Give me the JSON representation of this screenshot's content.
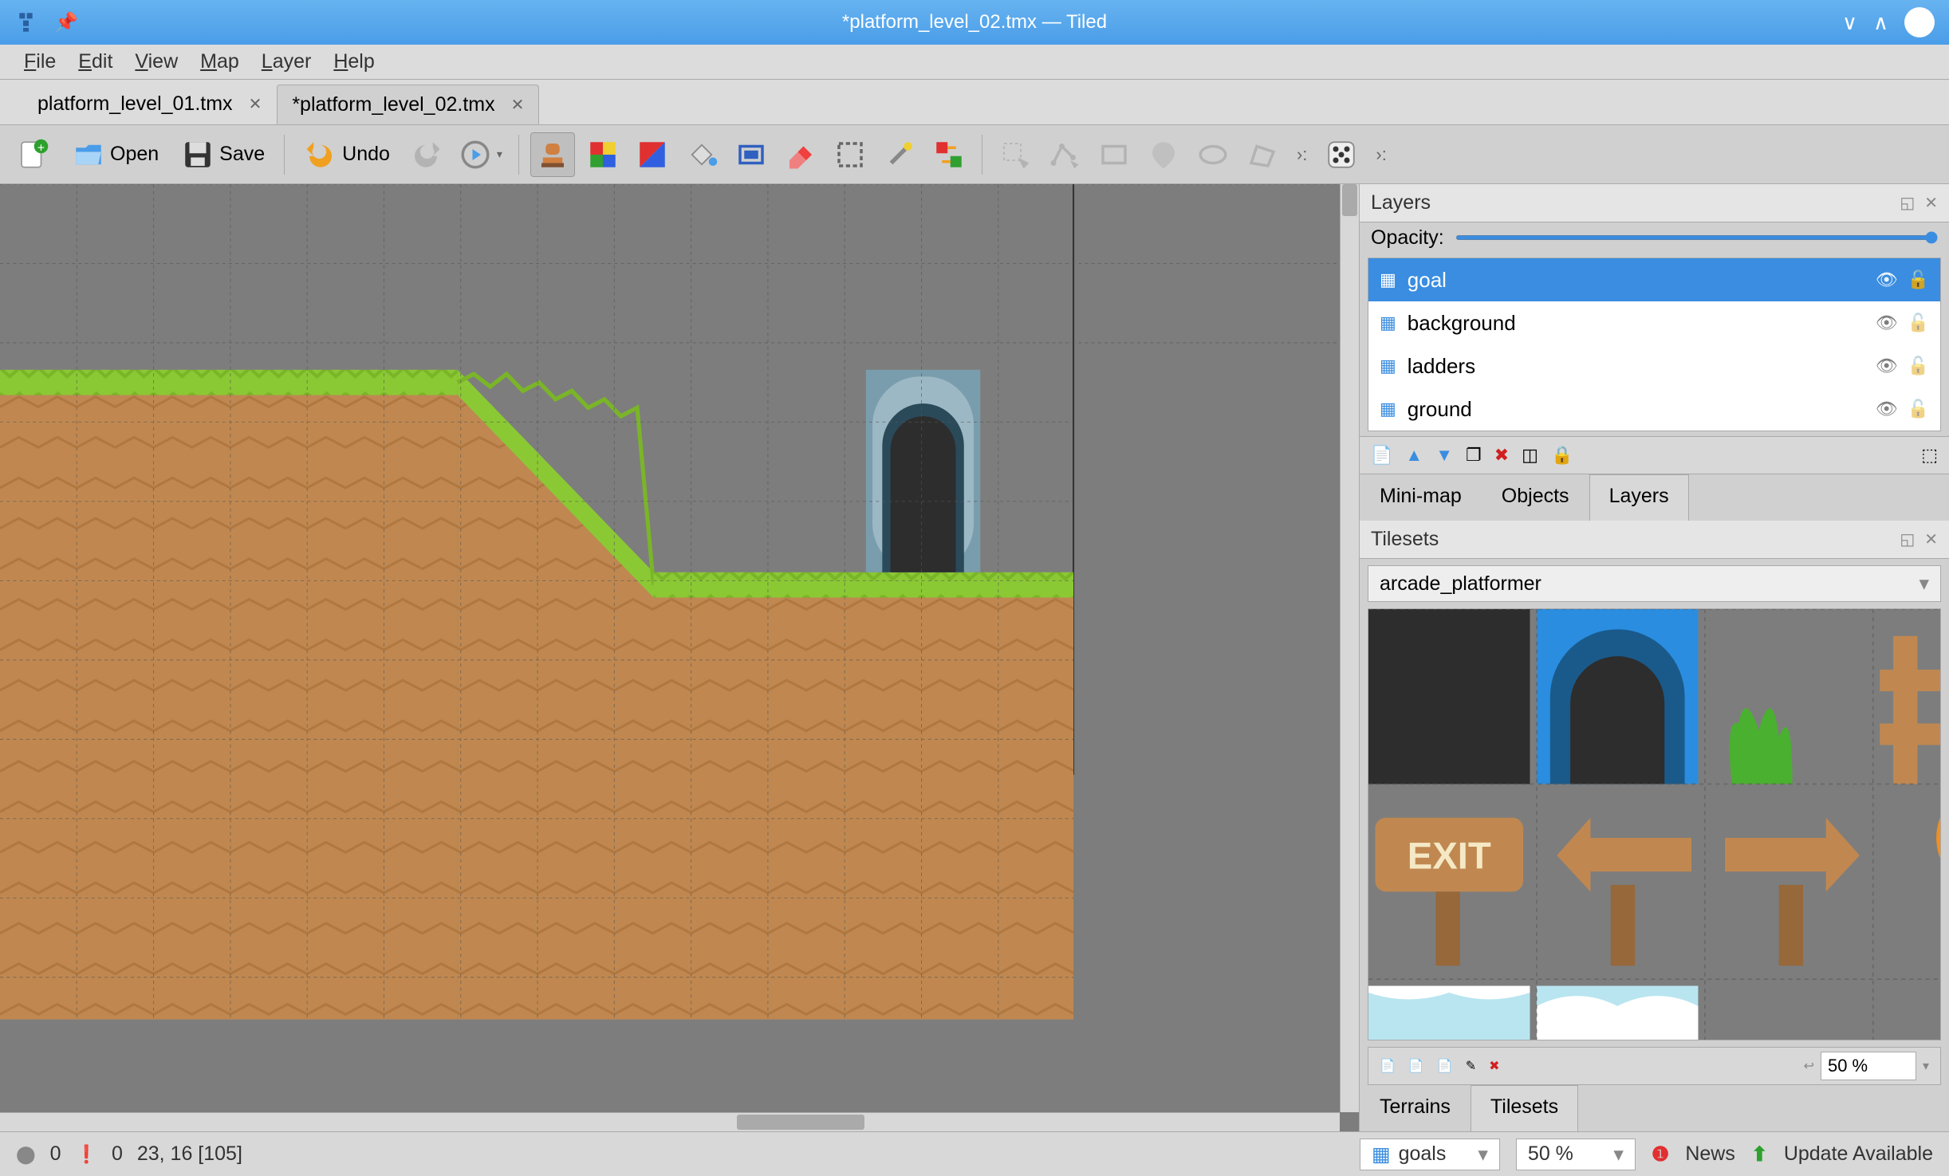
{
  "window": {
    "title": "*platform_level_02.tmx — Tiled"
  },
  "menu": [
    "File",
    "Edit",
    "View",
    "Map",
    "Layer",
    "Help"
  ],
  "tabs": [
    {
      "label": "platform_level_01.tmx",
      "active": false
    },
    {
      "label": "*platform_level_02.tmx",
      "active": true
    }
  ],
  "toolbar": {
    "open": "Open",
    "save": "Save",
    "undo": "Undo"
  },
  "layers_panel": {
    "title": "Layers",
    "opacity_label": "Opacity:",
    "layers": [
      {
        "name": "goal",
        "selected": true
      },
      {
        "name": "background",
        "selected": false
      },
      {
        "name": "ladders",
        "selected": false
      },
      {
        "name": "ground",
        "selected": false
      }
    ],
    "tabs": [
      "Mini-map",
      "Objects",
      "Layers"
    ],
    "active_tab": 2
  },
  "tilesets_panel": {
    "title": "Tilesets",
    "selected": "arcade_platformer",
    "zoom": "50 %",
    "tabs": [
      "Terrains",
      "Tilesets"
    ],
    "active_tab": 1
  },
  "statusbar": {
    "errors": "0",
    "warnings": "0",
    "coords": "23, 16 [105]",
    "layer_select": "goals",
    "zoom": "50 %",
    "news": "News",
    "update": "Update Available"
  }
}
